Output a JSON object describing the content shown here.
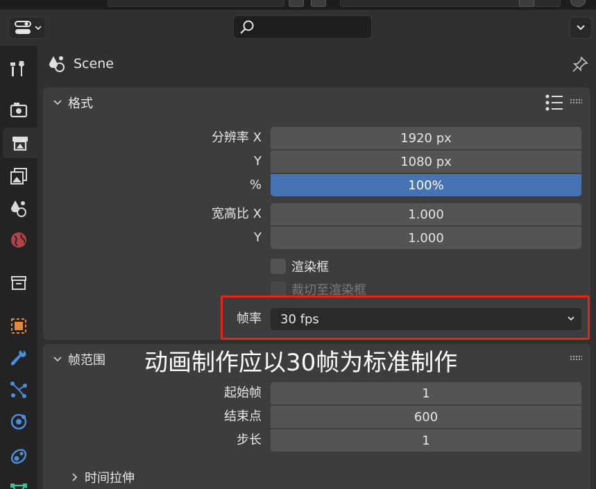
{
  "header": {
    "search_placeholder": ""
  },
  "context": {
    "title": "Scene"
  },
  "format_panel": {
    "title": "格式",
    "resolution_x_label": "分辨率 X",
    "resolution_x_value": "1920 px",
    "resolution_y_label": "Y",
    "resolution_y_value": "1080 px",
    "percent_label": "%",
    "percent_value": "100%",
    "aspect_x_label": "宽高比 X",
    "aspect_x_value": "1.000",
    "aspect_y_label": "Y",
    "aspect_y_value": "1.000",
    "render_region_label": "渲染框",
    "crop_label": "裁切至渲染框",
    "frame_rate_label": "帧率",
    "frame_rate_value": "30 fps"
  },
  "frame_range_panel": {
    "title": "帧范围",
    "start_label": "起始帧",
    "start_value": "1",
    "end_label": "结束点",
    "end_value": "600",
    "step_label": "步长",
    "step_value": "1"
  },
  "time_stretch": {
    "title": "时间拉伸"
  },
  "annotation": {
    "text": "动画制作应以30帧为标准制作",
    "box_color": "#e4261a"
  },
  "colors": {
    "accent_blue": "#4772b3",
    "panel_bg": "#3d3d3d",
    "field_bg": "#545454"
  },
  "icons": {
    "sidebar": [
      "tool-icon",
      "render-icon",
      "output-icon",
      "view-layer-icon",
      "scene-icon",
      "world-icon",
      "collection-icon",
      "object-icon",
      "modifier-icon",
      "particles-icon",
      "physics-icon",
      "constraints-icon",
      "data-icon"
    ]
  }
}
